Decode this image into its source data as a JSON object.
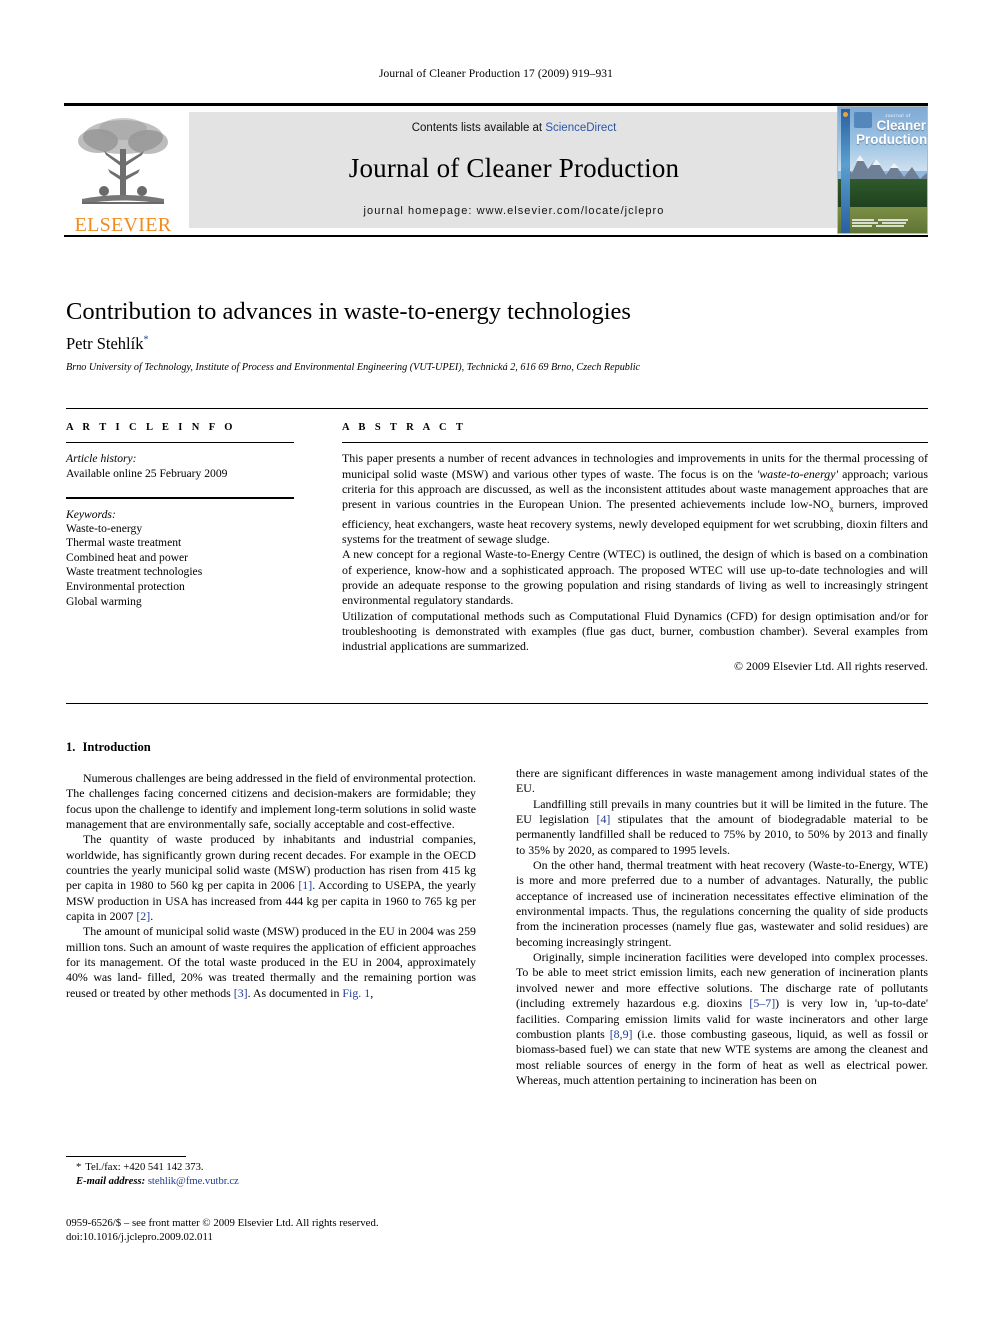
{
  "running_head": "Journal of Cleaner Production 17 (2009) 919–931",
  "masthead": {
    "contents_prefix": "Contents lists available at ",
    "sciencedirect": "ScienceDirect",
    "journal_name": "Journal of Cleaner Production",
    "homepage": "journal homepage: www.elsevier.com/locate/jclepro",
    "publisher_wordmark": "ELSEVIER",
    "publisher_color": "#F08C1E",
    "link_color": "#2b55a8",
    "band_color": "#e3e3e3",
    "cover": {
      "kicker": "Journal of",
      "line1": "Cleaner",
      "line2": "Production"
    }
  },
  "article": {
    "title": "Contribution to advances in waste-to-energy technologies",
    "author": "Petr Stehlík",
    "author_marker": "*",
    "affiliation": "Brno University of Technology, Institute of Process and Environmental Engineering (VUT-UPEI), Technická 2, 616 69 Brno, Czech Republic"
  },
  "article_info": {
    "heading": "A R T I C L E   I N F O",
    "history_label": "Article history:",
    "history_value": "Available online 25 February 2009",
    "keywords_label": "Keywords:",
    "keywords": [
      "Waste-to-energy",
      "Thermal waste treatment",
      "Combined heat and power",
      "Waste treatment technologies",
      "Environmental protection",
      "Global warming"
    ]
  },
  "abstract": {
    "heading": "A B S T R A C T",
    "paragraphs": [
      "This paper presents a number of recent advances in technologies and improvements in units for the thermal processing of municipal solid waste (MSW) and various other types of waste. The focus is on the 'waste-to-energy' approach; various criteria for this approach are discussed, as well as the inconsistent attitudes about waste management approaches that are present in various countries in the European Union. The presented achievements include low-NOx burners, improved efficiency, heat exchangers, waste heat recovery systems, newly developed equipment for wet scrubbing, dioxin filters and systems for the treatment of sewage sludge.",
      "A new concept for a regional Waste-to-Energy Centre (WTEC) is outlined, the design of which is based on a combination of experience, know-how and a sophisticated approach. The proposed WTEC will use up-to-date technologies and will provide an adequate response to the growing population and rising standards of living as well to increasingly stringent environmental regulatory standards.",
      "Utilization of computational methods such as Computational Fluid Dynamics (CFD) for design optimisation and/or for troubleshooting is demonstrated with examples (flue gas duct, burner, combustion chamber). Several examples from industrial applications are summarized."
    ],
    "copyright": "© 2009 Elsevier Ltd. All rights reserved."
  },
  "body": {
    "section_number": "1.",
    "section_title": "Introduction",
    "left_paragraphs": [
      "Numerous challenges are being addressed in the field of environmental protection. The challenges facing concerned citizens and decision-makers are formidable; they focus upon the challenge to identify and implement long-term solutions in solid waste management that are environmentally safe, socially acceptable and cost-effective.",
      "The quantity of waste produced by inhabitants and industrial companies, worldwide, has significantly grown during recent decades. For example in the OECD countries the yearly municipal solid waste (MSW) production has risen from 415 kg per capita in 1980 to 560 kg per capita in 2006 [1]. According to USEPA, the yearly MSW production in USA has increased from 444 kg per capita in 1960 to 765 kg per capita in 2007 [2].",
      "The amount of municipal solid waste (MSW) produced in the EU in 2004 was 259 million tons. Such an amount of waste requires the application of efficient approaches for its management. Of the total waste produced in the EU in 2004, approximately 40% was landfilled, 20% was treated thermally and the remaining portion was reused or treated by other methods [3]. As documented in Fig. 1,"
    ],
    "right_paragraphs": [
      "there are significant differences in waste management among individual states of the EU.",
      "Landfilling still prevails in many countries but it will be limited in the future. The EU legislation [4] stipulates that the amount of biodegradable material to be permanently landfilled shall be reduced to 75% by 2010, to 50% by 2013 and finally to 35% by 2020, as compared to 1995 levels.",
      "On the other hand, thermal treatment with heat recovery (Waste-to-Energy, WTE) is more and more preferred due to a number of advantages. Naturally, the public acceptance of increased use of incineration necessitates effective elimination of the environmental impacts. Thus, the regulations concerning the quality of side products from the incineration processes (namely flue gas, wastewater and solid residues) are becoming increasingly stringent.",
      "Originally, simple incineration facilities were developed into complex processes. To be able to meet strict emission limits, each new generation of incineration plants involved newer and more effective solutions. The discharge rate of pollutants (including extremely hazardous e.g. dioxins [5–7]) is very low in, 'up-to-date' facilities. Comparing emission limits valid for waste incinerators and other large combustion plants [8,9] (i.e. those combusting gaseous, liquid, as well as fossil or biomass-based fuel) we can state that new WTE systems are among the cleanest and most reliable sources of energy in the form of heat as well as electrical power. Whereas, much attention pertaining to incineration has been on"
    ],
    "reference_color": "#1f3a93"
  },
  "footnote": {
    "marker": "*",
    "tel": "Tel./fax: +420 541 142 373.",
    "email_label": "E-mail address:",
    "email": "stehlik@fme.vutbr.cz"
  },
  "imprint": {
    "line1": "0959-6526/$ – see front matter © 2009 Elsevier Ltd. All rights reserved.",
    "line2": "doi:10.1016/j.jclepro.2009.02.011"
  }
}
